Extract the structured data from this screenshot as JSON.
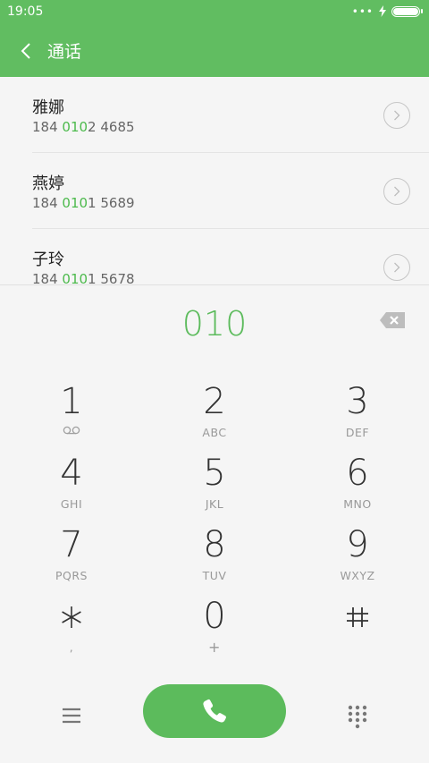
{
  "status": {
    "time": "19:05"
  },
  "header": {
    "title": "通话"
  },
  "contacts": [
    {
      "name": "雅娜",
      "number_prefix": "184 ",
      "number_match": "010",
      "number_suffix": "2 4685"
    },
    {
      "name": "燕婷",
      "number_prefix": "184 ",
      "number_match": "010",
      "number_suffix": "1 5689"
    },
    {
      "name": "子玲",
      "number_prefix": "184 ",
      "number_match": "010",
      "number_suffix": "1 5678"
    }
  ],
  "dialer": {
    "input": "010"
  },
  "keys": [
    {
      "digit": "1",
      "letters": ""
    },
    {
      "digit": "2",
      "letters": "ABC"
    },
    {
      "digit": "3",
      "letters": "DEF"
    },
    {
      "digit": "4",
      "letters": "GHI"
    },
    {
      "digit": "5",
      "letters": "JKL"
    },
    {
      "digit": "6",
      "letters": "MNO"
    },
    {
      "digit": "7",
      "letters": "PQRS"
    },
    {
      "digit": "8",
      "letters": "TUV"
    },
    {
      "digit": "9",
      "letters": "WXYZ"
    },
    {
      "digit": "",
      "letters": ","
    },
    {
      "digit": "0",
      "letters": "+"
    },
    {
      "digit": "",
      "letters": ""
    }
  ],
  "colors": {
    "accent": "#61bd61",
    "highlight": "#4cba4c"
  }
}
